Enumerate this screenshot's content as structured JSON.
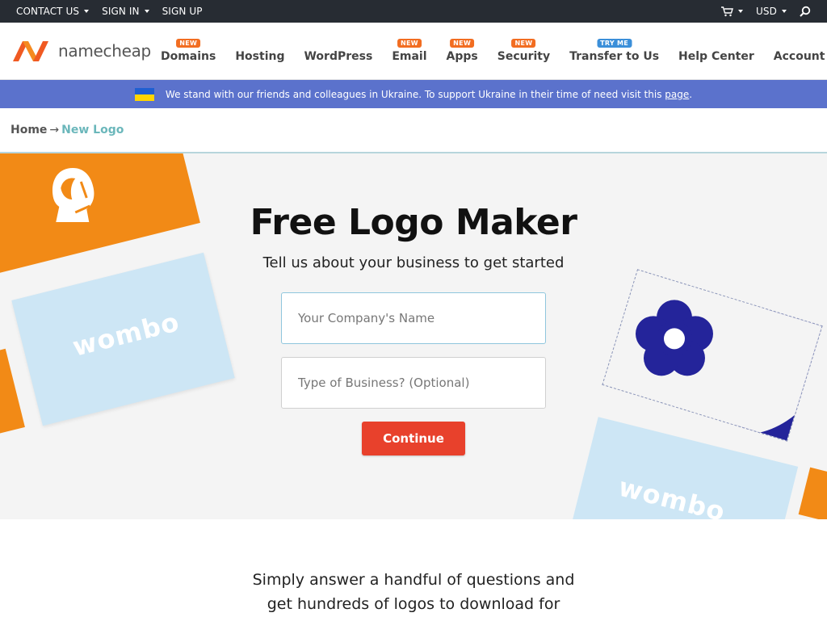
{
  "topbar": {
    "contact_us": "CONTACT US",
    "sign_in": "SIGN IN",
    "sign_up": "SIGN UP",
    "currency": "USD"
  },
  "brand": {
    "name": "namecheap",
    "accent": "#f26d21"
  },
  "nav": {
    "items": [
      {
        "label": "Domains",
        "badge": "NEW"
      },
      {
        "label": "Hosting",
        "badge": ""
      },
      {
        "label": "WordPress",
        "badge": ""
      },
      {
        "label": "Email",
        "badge": "NEW"
      },
      {
        "label": "Apps",
        "badge": "NEW"
      },
      {
        "label": "Security",
        "badge": "NEW"
      },
      {
        "label": "Transfer to Us",
        "badge": "TRY ME"
      },
      {
        "label": "Help Center",
        "badge": ""
      },
      {
        "label": "Account",
        "badge": ""
      }
    ]
  },
  "banner": {
    "text": "We stand with our friends and colleagues in Ukraine. To support Ukraine in their time of need visit this",
    "link": "page",
    "end": ".",
    "color": "#5b72cc"
  },
  "breadcrumb": {
    "home": "Home",
    "separator": "→",
    "current": "New Logo"
  },
  "hero": {
    "title": "Free Logo Maker",
    "subtitle": "Tell us about your business to get started",
    "company_placeholder": "Your Company's Name",
    "business_placeholder": "Type of Business? (Optional)",
    "continue_label": "Continue",
    "card_text_left": "wombo",
    "card_text_right": "wombo"
  },
  "intro": {
    "line1": "Simply answer a handful of questions and",
    "line2": "get hundreds of logos to download for"
  }
}
